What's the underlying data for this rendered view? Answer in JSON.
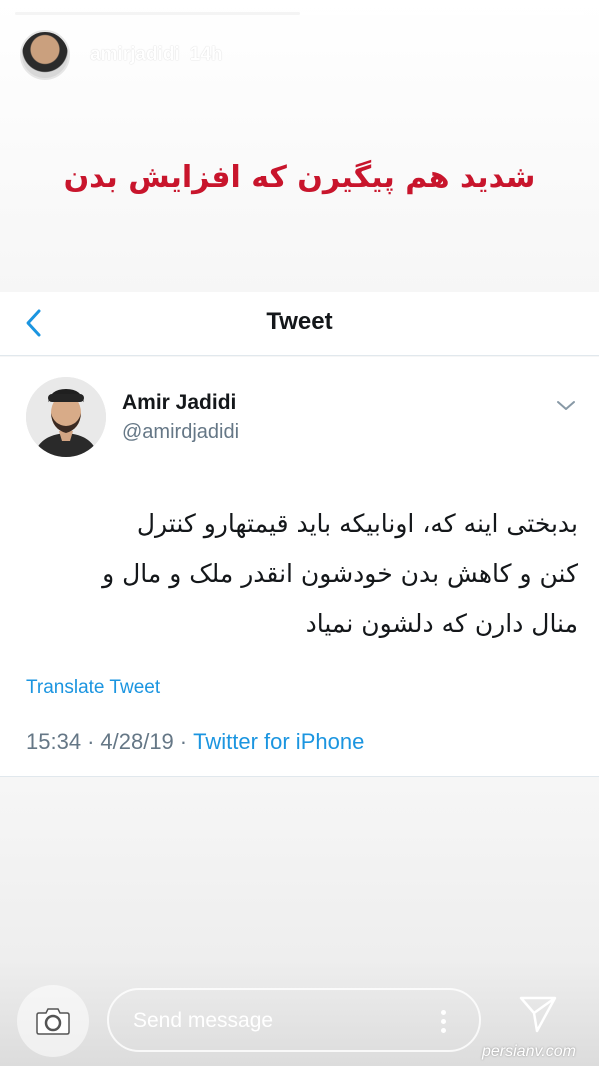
{
  "story": {
    "username": "amirjadidi",
    "time": "14h",
    "progress": 0.5,
    "caption": "شدید هم پیگیرن که افزایش بدن"
  },
  "tweet_view": {
    "header_title": "Tweet",
    "back_icon": "chevron-left-icon",
    "accent_color": "#1b95e0",
    "author": {
      "name": "Amir Jadidi",
      "handle": "@amirdjadidi"
    },
    "text_lines": [
      "بدبختی اینه که، اونابیکه باید قیمتهارو کنترل",
      "کنن و کاهش بدن خودشون انقدر ملک و مال و",
      "منال دارن که دلشون نمیاد"
    ],
    "translate_label": "Translate Tweet",
    "time": "15:34",
    "date": "4/28/19",
    "source": "Twitter for iPhone",
    "separator": "·"
  },
  "footer": {
    "camera_icon": "camera-icon",
    "message_placeholder": "Send message",
    "more_icon": "more-options-icon",
    "send_icon": "send-icon"
  },
  "watermark": "persianv.com",
  "colors": {
    "caption": "#c8152c",
    "handle": "#657786",
    "link": "#1b95e0"
  }
}
